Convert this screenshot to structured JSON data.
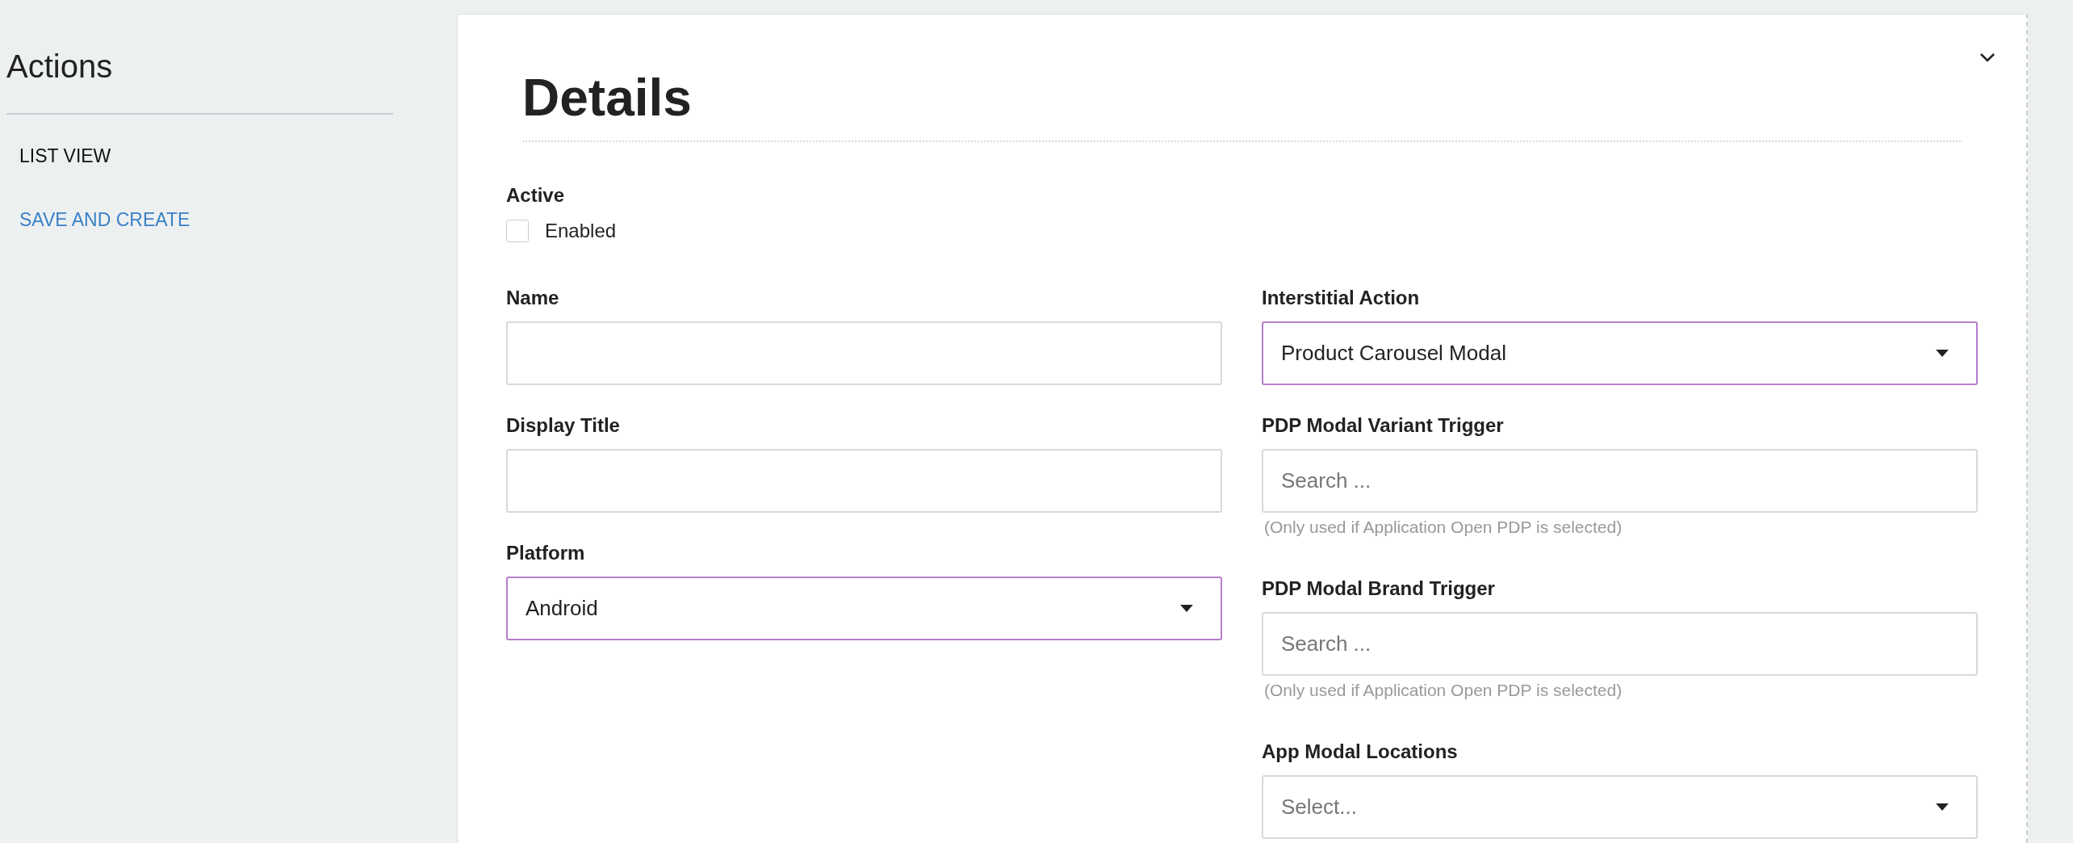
{
  "sidebar": {
    "title": "Actions",
    "items": [
      {
        "label": "LIST VIEW",
        "kind": "plain"
      },
      {
        "label": "SAVE AND CREATE",
        "kind": "link"
      }
    ]
  },
  "panel": {
    "title": "Details",
    "active": {
      "label": "Active",
      "option": "Enabled",
      "checked": false
    },
    "left_fields": [
      {
        "label": "Name",
        "kind": "text",
        "highlighted": false
      },
      {
        "label": "Display Title",
        "kind": "text",
        "highlighted": false
      },
      {
        "label": "Platform",
        "kind": "select",
        "value": "Android",
        "highlighted": true
      }
    ],
    "right_fields": [
      {
        "label": "Interstitial Action",
        "kind": "select",
        "value": "Product Carousel Modal",
        "highlighted": true
      },
      {
        "label": "PDP Modal Variant Trigger",
        "kind": "search",
        "placeholder": "Search ...",
        "help": "(Only used if Application Open PDP is selected)",
        "highlighted": false
      },
      {
        "label": "PDP Modal Brand Trigger",
        "kind": "search",
        "placeholder": "Search ...",
        "help": "(Only used if Application Open PDP is selected)",
        "highlighted": false
      },
      {
        "label": "App Modal Locations",
        "kind": "select",
        "placeholder": "Select...",
        "highlighted": false
      }
    ]
  }
}
